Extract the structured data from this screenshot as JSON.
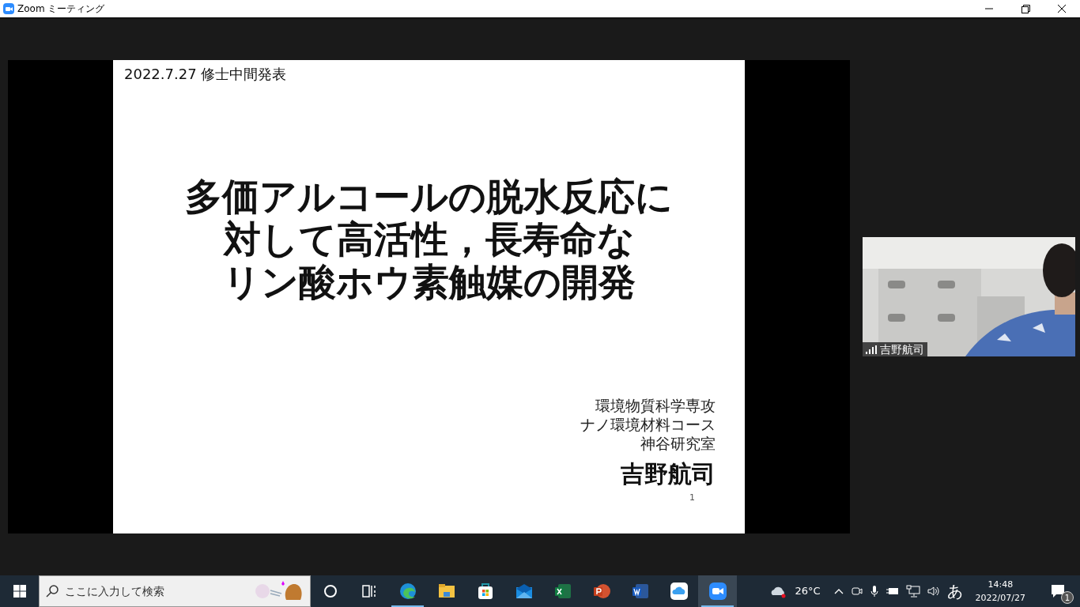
{
  "window": {
    "title": "Zoom ミーティング"
  },
  "slide": {
    "header": "2022.7.27 修士中間発表",
    "title_lines": [
      "多価アルコールの脱水反応に",
      "対して高活性，長寿命な",
      "リン酸ホウ素触媒の開発"
    ],
    "affiliation": [
      "環境物質科学専攻",
      "ナノ環境材料コース",
      "神谷研究室"
    ],
    "presenter": "吉野航司",
    "page_number": "1"
  },
  "video": {
    "kind": "picture",
    "name": "吉野航司"
  },
  "taskbar": {
    "search": {
      "placeholder": "ここに入力して検索"
    },
    "apps": [
      {
        "kind": "cortana",
        "running": false,
        "selected": false
      },
      {
        "kind": "taskview",
        "running": false,
        "selected": false
      },
      {
        "kind": "edge",
        "running": true,
        "selected": false
      },
      {
        "kind": "explorer",
        "running": false,
        "selected": false
      },
      {
        "kind": "store",
        "running": false,
        "selected": false
      },
      {
        "kind": "mail",
        "running": false,
        "selected": false
      },
      {
        "kind": "excel",
        "running": false,
        "selected": false
      },
      {
        "kind": "powerpoint",
        "running": false,
        "selected": false
      },
      {
        "kind": "word",
        "running": false,
        "selected": false
      },
      {
        "kind": "icloud",
        "running": false,
        "selected": false
      },
      {
        "kind": "zoom",
        "running": true,
        "selected": true
      }
    ],
    "tray": {
      "temperature": "26°C",
      "ime": "あ",
      "time": "14:48",
      "date": "2022/07/27",
      "notifications": "1"
    }
  }
}
